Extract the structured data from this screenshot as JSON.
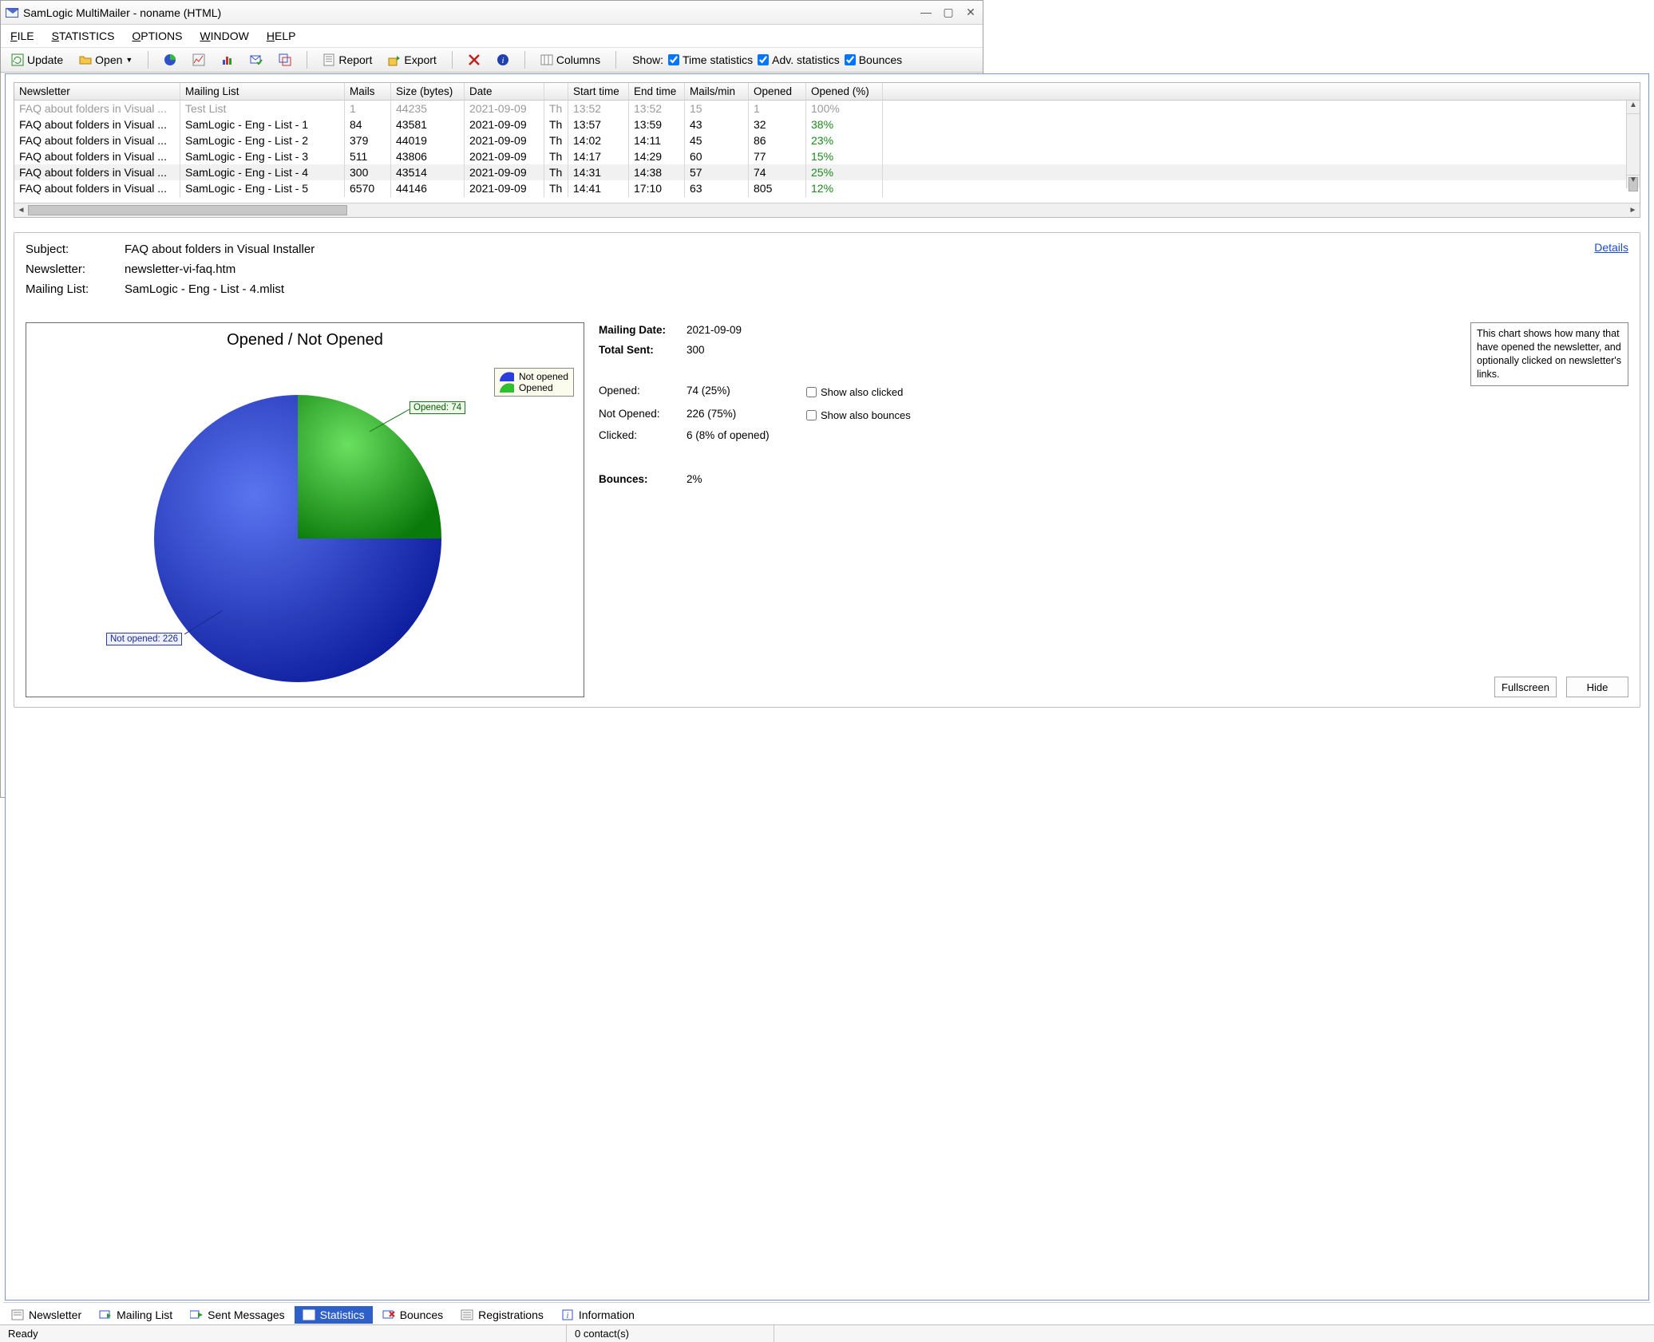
{
  "window": {
    "title": "SamLogic MultiMailer - noname  (HTML)"
  },
  "menubar": {
    "file": "FILE",
    "statistics": "STATISTICS",
    "options": "OPTIONS",
    "window": "WINDOW",
    "help": "HELP"
  },
  "toolbar": {
    "update": "Update",
    "open": "Open",
    "report": "Report",
    "export": "Export",
    "columns": "Columns",
    "show_label": "Show:",
    "time_stats": "Time statistics",
    "adv_stats": "Adv. statistics",
    "bounces": "Bounces"
  },
  "grid": {
    "headers": [
      "Newsletter",
      "Mailing List",
      "Mails",
      "Size (bytes)",
      "Date",
      "",
      "Start time",
      "End time",
      "Mails/min",
      "Opened",
      "Opened (%)"
    ],
    "rows": [
      {
        "gray": true,
        "cells": [
          "FAQ about folders in Visual ...",
          "Test List",
          "1",
          "44235",
          "2021-09-09",
          "Th",
          "13:52",
          "13:52",
          "15",
          "1",
          "100%"
        ]
      },
      {
        "cells": [
          "FAQ about folders in Visual ...",
          "SamLogic - Eng - List - 1",
          "84",
          "43581",
          "2021-09-09",
          "Th",
          "13:57",
          "13:59",
          "43",
          "32",
          "38%"
        ],
        "pctGreen": true
      },
      {
        "cells": [
          "FAQ about folders in Visual ...",
          "SamLogic - Eng - List - 2",
          "379",
          "44019",
          "2021-09-09",
          "Th",
          "14:02",
          "14:11",
          "45",
          "86",
          "23%"
        ],
        "pctGreen": true
      },
      {
        "cells": [
          "FAQ about folders in Visual ...",
          "SamLogic - Eng - List - 3",
          "511",
          "43806",
          "2021-09-09",
          "Th",
          "14:17",
          "14:29",
          "60",
          "77",
          "15%"
        ],
        "pctGreen": true
      },
      {
        "sel": true,
        "cells": [
          "FAQ about folders in Visual ...",
          "SamLogic - Eng - List - 4",
          "300",
          "43514",
          "2021-09-09",
          "Th",
          "14:31",
          "14:38",
          "57",
          "74",
          "25%"
        ],
        "pctGreen": true
      },
      {
        "cells": [
          "FAQ about folders in Visual ...",
          "SamLogic - Eng - List - 5",
          "6570",
          "44146",
          "2021-09-09",
          "Th",
          "14:41",
          "17:10",
          "63",
          "805",
          "12%"
        ],
        "pctGreen": true
      }
    ]
  },
  "detail": {
    "subject_label": "Subject:",
    "subject_value": "FAQ about folders in Visual Installer",
    "newsletter_label": "Newsletter:",
    "newsletter_value": "newsletter-vi-faq.htm",
    "mailinglist_label": "Mailing List:",
    "mailinglist_value": "SamLogic - Eng - List - 4.mlist",
    "details_link": "Details"
  },
  "chart_data": {
    "type": "pie",
    "title": "Opened / Not Opened",
    "series": [
      {
        "name": "Not opened",
        "value": 226,
        "pct": 75,
        "color": "#2a3edb"
      },
      {
        "name": "Opened",
        "value": 74,
        "pct": 25,
        "color": "#2fbf2f"
      }
    ],
    "legend": [
      "Not opened",
      "Opened"
    ],
    "callouts": {
      "opened": "Opened: 74",
      "not_opened": "Not opened: 226"
    }
  },
  "stats": {
    "mailing_date_label": "Mailing Date:",
    "mailing_date": "2021-09-09",
    "total_sent_label": "Total Sent:",
    "total_sent": "300",
    "opened_label": "Opened:",
    "opened": "74  (25%)",
    "not_opened_label": "Not Opened:",
    "not_opened": "226  (75%)",
    "clicked_label": "Clicked:",
    "clicked": "6  (8% of opened)",
    "bounces_label": "Bounces:",
    "bounces": "2%",
    "help_text": "This chart shows how many that have opened the newsletter, and optionally clicked on newsletter's links.",
    "show_clicked": "Show also clicked",
    "show_bounces": "Show also bounces",
    "fullscreen": "Fullscreen",
    "hide": "Hide"
  },
  "tabs": {
    "newsletter": "Newsletter",
    "mailing_list": "Mailing List",
    "sent": "Sent Messages",
    "statistics": "Statistics",
    "bounces": "Bounces",
    "registrations": "Registrations",
    "information": "Information"
  },
  "statusbar": {
    "ready": "Ready",
    "contacts": "0 contact(s)"
  }
}
